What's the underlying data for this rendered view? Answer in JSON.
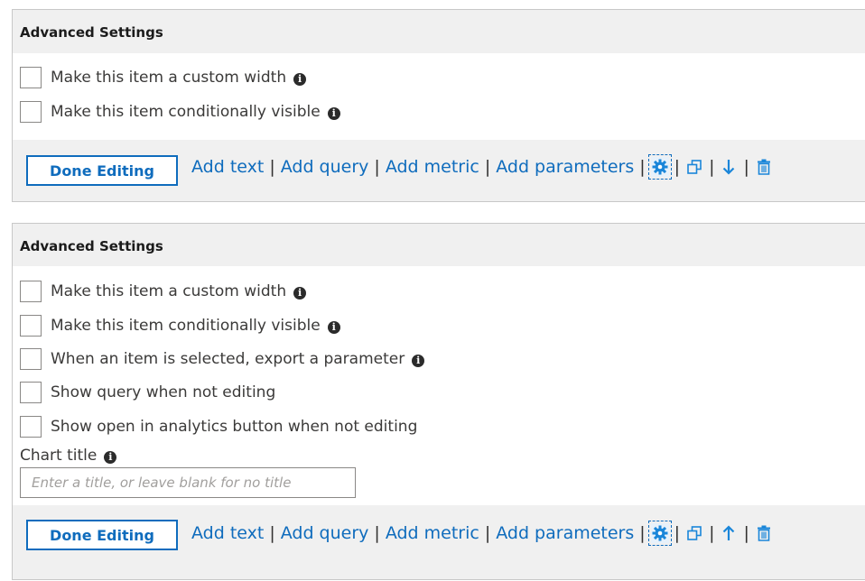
{
  "panel1": {
    "header": "Advanced Settings",
    "options": [
      {
        "label": "Make this item a custom width",
        "info": true
      },
      {
        "label": "Make this item conditionally visible",
        "info": true
      }
    ],
    "toolbar": {
      "done_label": "Done Editing",
      "links": [
        "Add text",
        "Add query",
        "Add metric",
        "Add parameters"
      ],
      "separator": "|",
      "icons": [
        "settings-icon",
        "clone-icon",
        "move-down-icon",
        "delete-icon"
      ]
    }
  },
  "panel2": {
    "header": "Advanced Settings",
    "options": [
      {
        "label": "Make this item a custom width",
        "info": true
      },
      {
        "label": "Make this item conditionally visible",
        "info": true
      },
      {
        "label": "When an item is selected, export a parameter",
        "info": true
      },
      {
        "label": "Show query when not editing",
        "info": false
      },
      {
        "label": "Show open in analytics button when not editing",
        "info": false
      }
    ],
    "chart_title": {
      "label": "Chart title",
      "value": "",
      "placeholder": "Enter a title, or leave blank for no title"
    },
    "toolbar": {
      "done_label": "Done Editing",
      "links": [
        "Add text",
        "Add query",
        "Add metric",
        "Add parameters"
      ],
      "separator": "|",
      "icons": [
        "settings-icon",
        "clone-icon",
        "move-up-icon",
        "delete-icon"
      ]
    }
  },
  "info_glyph": "i",
  "colors": {
    "link": "#0f6cbd",
    "header_bg": "#f0f0f0",
    "border": "#c8c8c8",
    "icon": "#1a86d9"
  }
}
